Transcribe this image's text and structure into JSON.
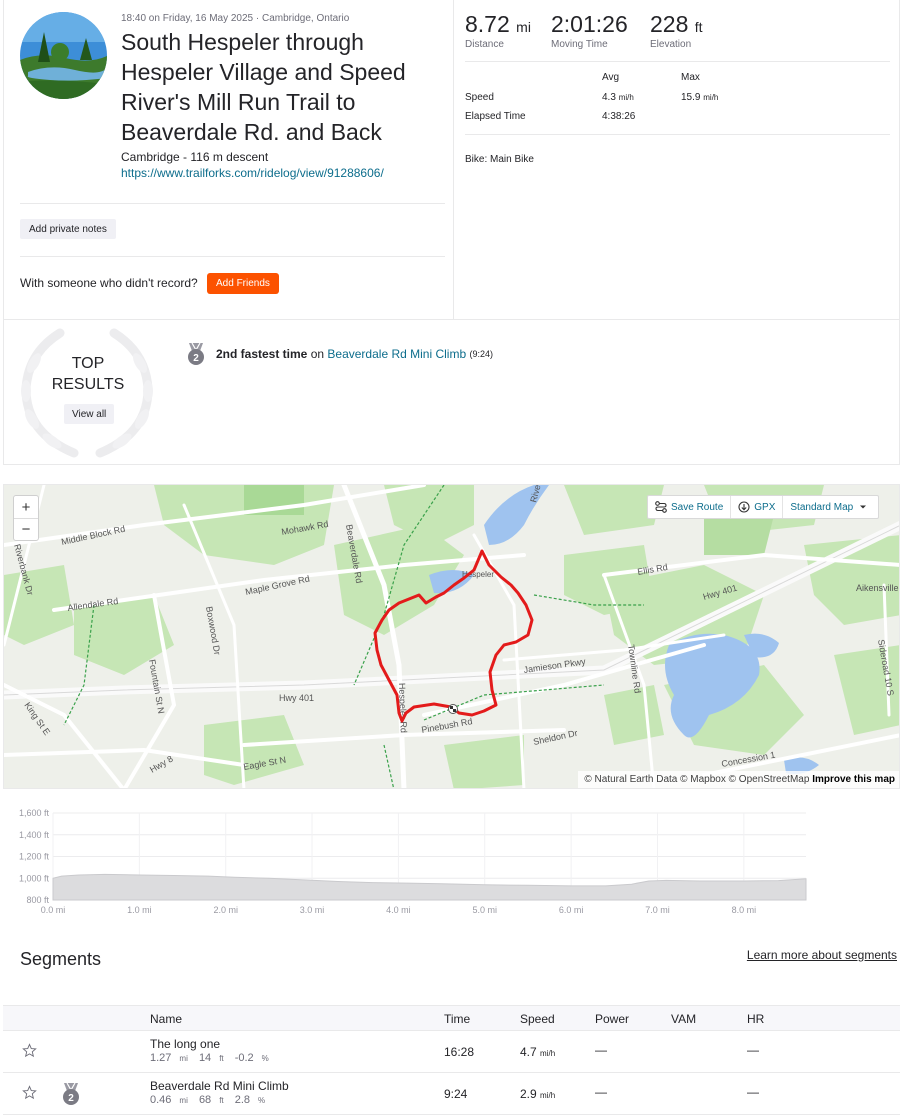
{
  "activity": {
    "date_line": "18:40 on Friday, 16 May 2025 · Cambridge, Ontario",
    "title": "South Hespeler through Hespeler Village and Speed River's Mill Run Trail to Beaverdale Rd. and Back",
    "location_line": "Cambridge - 116 m descent",
    "link": "https://www.trailforks.com/ridelog/view/91288606/",
    "add_notes_label": "Add private notes",
    "friends_text": "With someone who didn't record?",
    "add_friends_label": "Add Friends"
  },
  "stats": {
    "distance": {
      "value": "8.72",
      "unit": "mi",
      "label": "Distance"
    },
    "moving_time": {
      "value": "2:01:26",
      "label": "Moving Time"
    },
    "elevation": {
      "value": "228",
      "unit": "ft",
      "label": "Elevation"
    },
    "avg_header": "Avg",
    "max_header": "Max",
    "speed_label": "Speed",
    "speed_avg": "4.3",
    "speed_max": "15.9",
    "speed_unit": "mi/h",
    "elapsed_label": "Elapsed Time",
    "elapsed_avg": "4:38:26",
    "bike_line": "Bike: Main Bike"
  },
  "results": {
    "top_label_1": "TOP",
    "top_label_2": "RESULTS",
    "view_all_label": "View all",
    "achievement_rank": "2nd fastest time",
    "achievement_on": "on",
    "achievement_segment": "Beaverdale Rd Mini Climb",
    "achievement_time": "(9:24)",
    "medal_number": "2"
  },
  "map": {
    "zoom_in": "+",
    "zoom_out": "−",
    "save_route_label": "Save Route",
    "gpx_label": "GPX",
    "map_style_label": "Standard Map",
    "attribution_text": "© Natural Earth Data © Mapbox © OpenStreetMap",
    "improve_label": "Improve this map",
    "route_color": "#e31b1b",
    "labels": {
      "middle_block": "Middle Block Rd",
      "mohawk": "Mohawk Rd",
      "beaverdale": "Beaverdale Rd",
      "maple_grove": "Maple Grove Rd",
      "allendale": "Allendale Rd",
      "boxwood": "Boxwood Dr",
      "fountain": "Fountain St N",
      "hwy401": "Hwy 401",
      "hwy401_east": "Hwy 401",
      "hespeler_rd": "Hespeler Rd",
      "pinebush": "Pinebush Rd",
      "jamieson": "Jamieson Pkwy",
      "townline": "Townline Rd",
      "sheldon": "Sheldon Dr",
      "eagle": "Eagle St N",
      "hwy8": "Hwy 8",
      "king": "King St E",
      "riverbank": "Riverbank Dr",
      "ellis": "Ellis Rd",
      "aikensville": "Aikensville",
      "hespeler": "Hespeler",
      "concession": "Concession 1",
      "river": "River",
      "sideroad": "Sideroad 10 S"
    }
  },
  "elevation_chart": {
    "y_ticks": [
      "1,600 ft",
      "1,400 ft",
      "1,200 ft",
      "1,000 ft",
      "800 ft"
    ],
    "y_values": [
      1600,
      1400,
      1200,
      1000,
      800
    ],
    "x_ticks": [
      "0.0 mi",
      "1.0 mi",
      "2.0 mi",
      "3.0 mi",
      "4.0 mi",
      "5.0 mi",
      "6.0 mi",
      "7.0 mi",
      "8.0 mi"
    ],
    "x_values": [
      0,
      1,
      2,
      3,
      4,
      5,
      6,
      7,
      8
    ],
    "x_max": 8.72,
    "profile": [
      [
        0,
        1000
      ],
      [
        0.1,
        1020
      ],
      [
        0.3,
        1030
      ],
      [
        0.6,
        1035
      ],
      [
        1.0,
        1030
      ],
      [
        1.4,
        1025
      ],
      [
        1.8,
        1020
      ],
      [
        2.1,
        1010
      ],
      [
        2.5,
        1000
      ],
      [
        2.9,
        985
      ],
      [
        3.3,
        970
      ],
      [
        3.7,
        960
      ],
      [
        4.1,
        955
      ],
      [
        4.5,
        950
      ],
      [
        5.0,
        940
      ],
      [
        5.5,
        935
      ],
      [
        6.0,
        930
      ],
      [
        6.4,
        930
      ],
      [
        6.7,
        945
      ],
      [
        6.9,
        975
      ],
      [
        7.1,
        980
      ],
      [
        7.5,
        975
      ],
      [
        8.0,
        975
      ],
      [
        8.4,
        978
      ],
      [
        8.72,
        995
      ]
    ]
  },
  "segments": {
    "title": "Segments",
    "learn_more": "Learn more about segments",
    "headers": {
      "name": "Name",
      "time": "Time",
      "speed": "Speed",
      "power": "Power",
      "vam": "VAM",
      "hr": "HR"
    },
    "rows": [
      {
        "name": "The long one",
        "distance": "1.27",
        "distance_unit": "mi",
        "elev": "14",
        "elev_unit": "ft",
        "grade": "-0.2",
        "grade_unit": "%",
        "time": "16:28",
        "speed": "4.7",
        "speed_unit": "mi/h",
        "power": "—",
        "hr": "—"
      },
      {
        "name": "Beaverdale Rd Mini Climb",
        "distance": "0.46",
        "distance_unit": "mi",
        "elev": "68",
        "elev_unit": "ft",
        "grade": "2.8",
        "grade_unit": "%",
        "time": "9:24",
        "speed": "2.9",
        "speed_unit": "mi/h",
        "power": "—",
        "hr": "—",
        "medal": "2"
      }
    ]
  }
}
